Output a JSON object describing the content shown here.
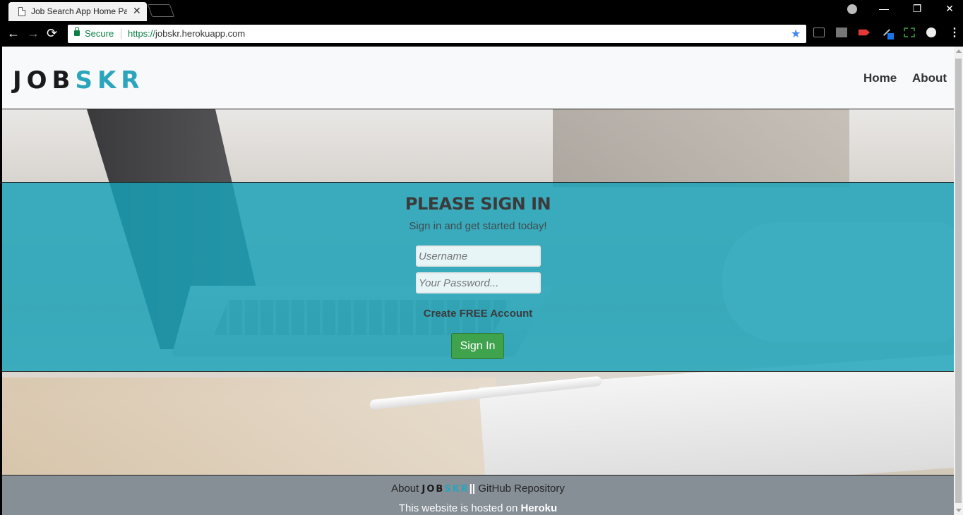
{
  "browser": {
    "tab_title": "Job Search App Home Pa",
    "tab_close": "✕",
    "secure_label": "Secure",
    "url_scheme": "https://",
    "url_rest": "jobskr.herokuapp.com",
    "window_controls": {
      "minimize": "—",
      "maximize": "❐",
      "close": "✕"
    },
    "nav": {
      "back": "←",
      "forward": "→",
      "reload": "⟳"
    },
    "menu": "⋮",
    "bookmark_star": "★"
  },
  "navbar": {
    "brand_part1": "JOB",
    "brand_part2": "SKR",
    "links": [
      "Home",
      "About"
    ]
  },
  "signin": {
    "title": "PLEASE SIGN IN",
    "subtitle": "Sign in and get started today!",
    "username_placeholder": "Username",
    "password_placeholder": "Your Password...",
    "create_account": "Create FREE Account",
    "submit": "Sign In"
  },
  "footer": {
    "about_prefix": "About",
    "brand_part1": "JOB",
    "brand_part2": "SKR",
    "separator": "||",
    "repo_link": "GitHub Repository",
    "hosted_text": "This website is hosted on",
    "host": "Heroku"
  },
  "colors": {
    "accent": "#17a2b8",
    "brand_teal": "#2ba5bb",
    "button_green": "#3fa34d",
    "footer_gray": "#868e96"
  }
}
